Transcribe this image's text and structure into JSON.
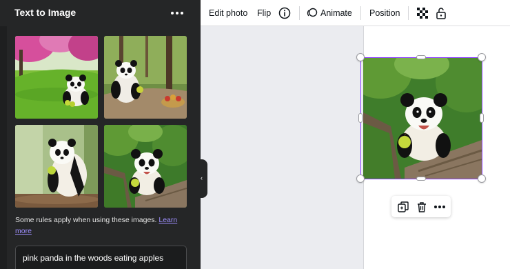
{
  "panel": {
    "title": "Text to Image",
    "more_icon": "more-horizontal-icon",
    "images": [
      {
        "alt_icon": "generated-image"
      },
      {
        "alt_icon": "generated-image"
      },
      {
        "alt_icon": "generated-image"
      },
      {
        "alt_icon": "generated-image"
      }
    ],
    "rules_text": "Some rules apply when using these images.",
    "learn_more": "Learn more",
    "prompt_value": "pink panda in the woods eating apples",
    "collapse_icon": "chevron-left-icon"
  },
  "toolbar": {
    "edit_photo": "Edit photo",
    "flip": "Flip",
    "info_icon": "info-icon",
    "animate": "Animate",
    "position": "Position",
    "transparency_icon": "transparency-icon",
    "lock_icon": "unlock-icon"
  },
  "context_menu": {
    "duplicate_icon": "duplicate-icon",
    "delete_icon": "trash-icon",
    "more_icon": "more-horizontal-icon"
  },
  "colors": {
    "panel_bg": "#252627",
    "accent_selection": "#8b3dff",
    "link": "#9f90ff",
    "canvas_bg": "#ebecf0"
  }
}
